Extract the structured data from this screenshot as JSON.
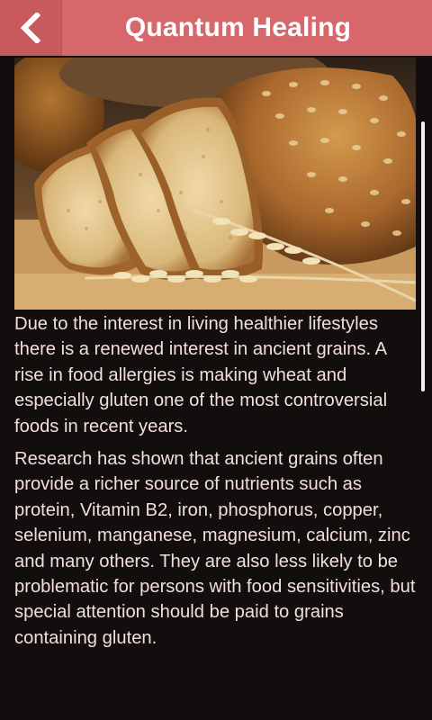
{
  "header": {
    "title": "Quantum Healing",
    "back_icon": "chevron-left-icon",
    "bg_color": "#d6676b"
  },
  "main": {
    "image": "bread-loaf-with-wheat-image",
    "paragraphs": [
      "Due to the interest in living healthier lifestyles there is a renewed interest in ancient grains. A rise in food allergies is making wheat and especially gluten one of the most controversial foods in recent years.",
      "Research has shown that ancient grains often provide a richer source of nutrients such as protein, Vitamin B2, iron, phosphorus, copper, selenium, manganese, magnesium, calcium, zinc and many others. They are also less likely to be problematic for persons with food sensitivities, but special attention should be paid to grains containing gluten."
    ],
    "text_color": "#f3dede",
    "bg_color": "#130e0e"
  }
}
